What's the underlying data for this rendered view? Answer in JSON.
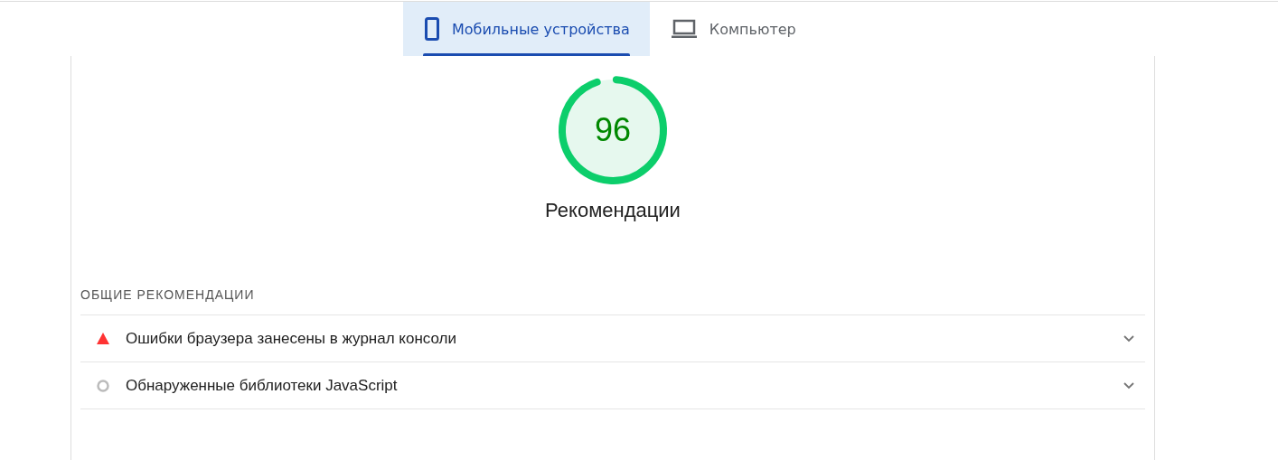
{
  "tabs": [
    {
      "label": "Мобильные устройства",
      "selected": true,
      "kind": "phone"
    },
    {
      "label": "Компьютер",
      "selected": false,
      "kind": "laptop"
    }
  ],
  "score": {
    "value": "96",
    "level": 0.96,
    "title": "Рекомендации"
  },
  "group": {
    "heading": "ОБЩИЕ РЕКОМЕНДАЦИИ",
    "audits": [
      {
        "title": "Ошибки браузера занесены в журнал консоли",
        "kind": "fail",
        "expanded": false
      },
      {
        "title": "Обнаруженные библиотеки JavaScript",
        "kind": "info",
        "expanded": false
      }
    ]
  }
}
